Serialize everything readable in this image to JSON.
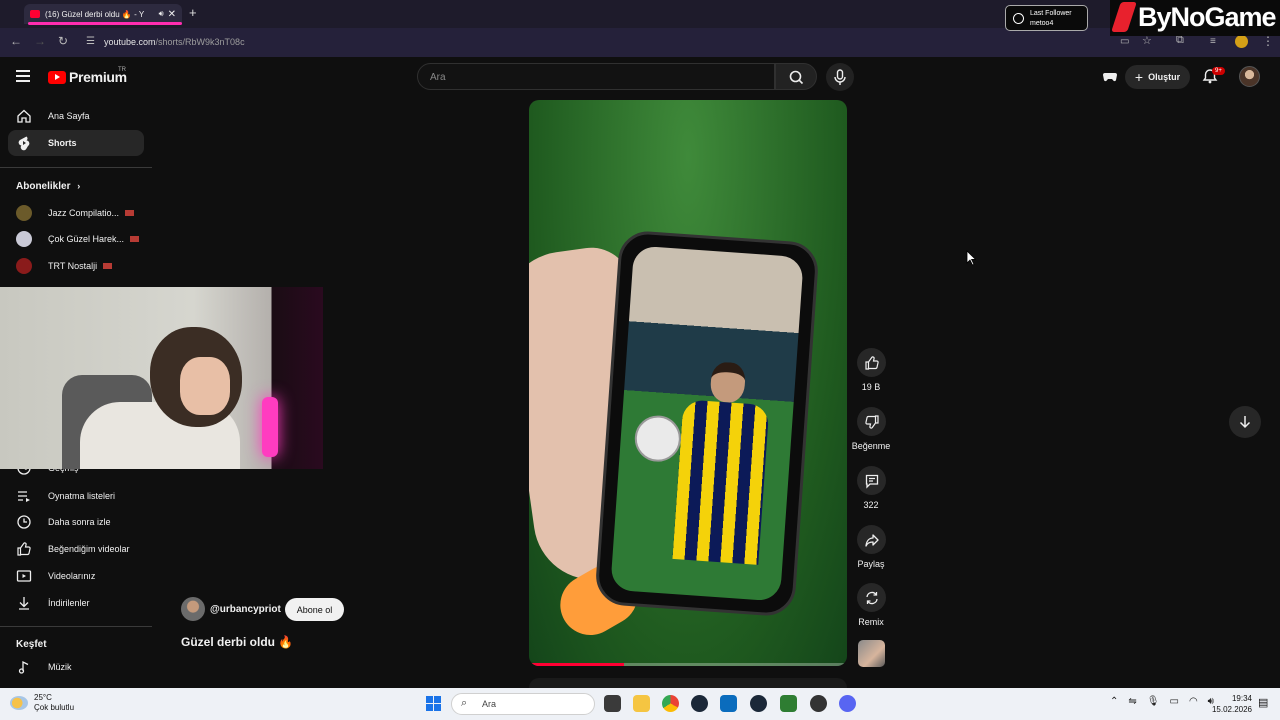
{
  "browser": {
    "tab_title": "(16) Güzel derbi oldu 🔥 - Y",
    "url_host": "youtube.com",
    "url_path": "/shorts/RbW9k3nT08c",
    "new_tab_symbol": "+"
  },
  "overlay": {
    "follower_title": "Last Follower",
    "follower_name": "metoo4",
    "brand": "ByNoGame"
  },
  "header": {
    "logo_text": "Premium",
    "region": "TR",
    "search_placeholder": "Ara",
    "create_label": "Oluştur",
    "notification_count": "9+"
  },
  "sidebar": {
    "main": [
      {
        "label": "Ana Sayfa",
        "icon": "home-icon"
      },
      {
        "label": "Shorts",
        "icon": "shorts-icon"
      }
    ],
    "subscriptions_heading": "Abonelikler",
    "subscriptions": [
      {
        "label": "Jazz Compilatio...",
        "color": "#6b5a2a"
      },
      {
        "label": "Çok Güzel Harek...",
        "color": "#c9c9d6"
      },
      {
        "label": "TRT Nostalji",
        "color": "#8a1b1b"
      }
    ],
    "you_items": [
      {
        "label": "Geçmiş",
        "icon": "history-icon"
      },
      {
        "label": "Oynatma listeleri",
        "icon": "playlists-icon"
      },
      {
        "label": "Daha sonra izle",
        "icon": "watch-later-icon"
      },
      {
        "label": "Beğendiğim videolar",
        "icon": "liked-icon"
      },
      {
        "label": "Videolarınız",
        "icon": "your-videos-icon"
      },
      {
        "label": "İndirilenler",
        "icon": "downloads-icon"
      }
    ],
    "explore_heading": "Keşfet",
    "explore": [
      {
        "label": "Müzik",
        "icon": "music-icon"
      }
    ]
  },
  "short": {
    "channel": "@urbancypriot",
    "subscribe_label": "Abone ol",
    "title": "Güzel derbi oldu",
    "title_emoji": "🔥",
    "progress": 0.3,
    "likes": "19 B",
    "dislike_label": "Beğenme",
    "comments": "322",
    "share_label": "Paylaş",
    "remix_label": "Remix"
  },
  "taskbar": {
    "temperature": "25°C",
    "weather": "Çok bulutlu",
    "search_placeholder": "Ara",
    "time": "19:34",
    "date": "15.02.2026"
  },
  "colors": {
    "yt_red": "#ff0000",
    "accent_red": "#ff0033",
    "bg": "#0f0f0f"
  }
}
